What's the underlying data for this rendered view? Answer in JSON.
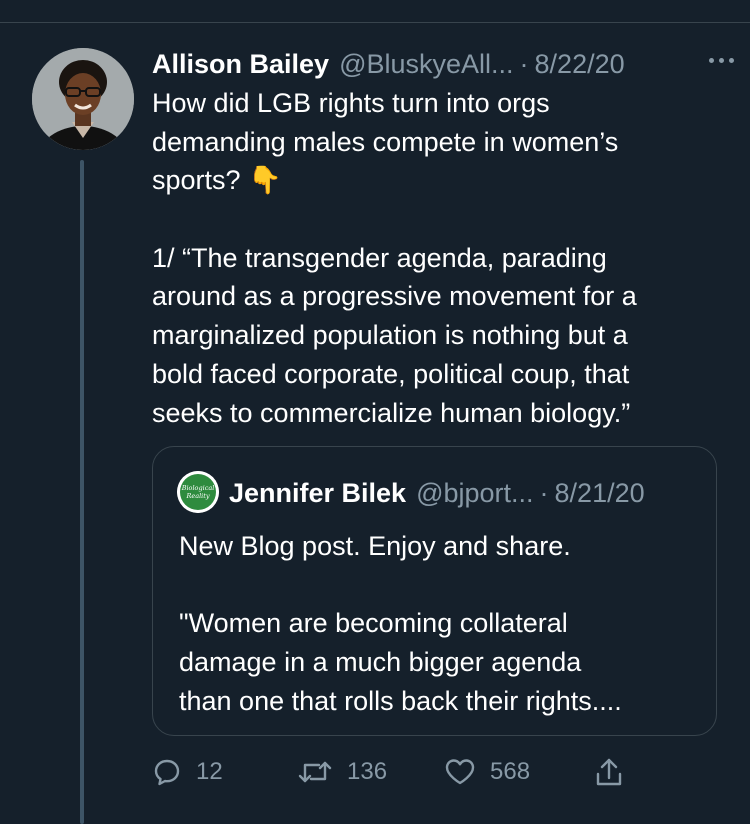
{
  "tweet": {
    "author": {
      "name": "Allison Bailey",
      "handle": "@BluskyeAll...",
      "date": "8/22/20",
      "separator": "·"
    },
    "text_lines": [
      "How did LGB rights turn into orgs",
      "demanding males compete in women’s",
      "sports? 👇",
      "",
      "1/ “The transgender agenda, parading",
      "around as a progressive movement for a",
      "marginalized population is nothing but a",
      "bold faced corporate, political coup, that",
      "seeks to commercialize human biology.”"
    ],
    "quoted": {
      "name": "Jennifer Bilek",
      "handle": "@bjport...",
      "date": "8/21/20",
      "separator": "·",
      "avatar_text": "Biological Reality",
      "text_lines": [
        "New Blog post.  Enjoy and share.",
        "",
        "\"Women are becoming collateral",
        "damage in a much bigger agenda",
        "than one that rolls back their rights...."
      ]
    },
    "actions": {
      "reply": {
        "icon": "reply-icon",
        "count": "12"
      },
      "retweet": {
        "icon": "retweet-icon",
        "count": "136"
      },
      "like": {
        "icon": "heart-icon",
        "count": "568"
      },
      "share": {
        "icon": "share-icon"
      }
    }
  },
  "colors": {
    "background": "#15202b",
    "text": "#ffffff",
    "secondary": "#8899a6",
    "border": "#38444d",
    "thread_line": "#3d5466"
  }
}
